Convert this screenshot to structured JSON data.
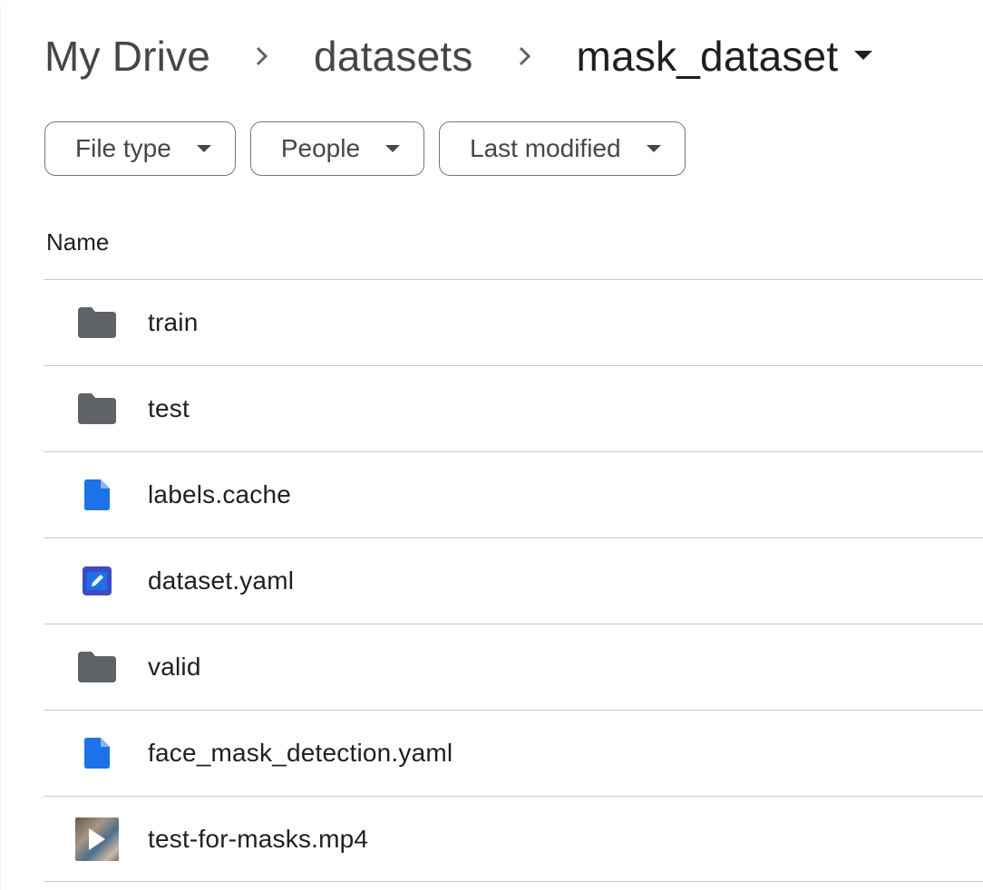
{
  "breadcrumb": {
    "items": [
      "My Drive",
      "datasets"
    ],
    "current": "mask_dataset"
  },
  "filters": [
    {
      "label": "File type"
    },
    {
      "label": "People"
    },
    {
      "label": "Last modified"
    }
  ],
  "table": {
    "header_name": "Name",
    "rows": [
      {
        "name": "train",
        "icon": "folder-icon"
      },
      {
        "name": "test",
        "icon": "folder-icon"
      },
      {
        "name": "labels.cache",
        "icon": "file-icon"
      },
      {
        "name": "dataset.yaml",
        "icon": "edit-file-icon"
      },
      {
        "name": "valid",
        "icon": "folder-icon"
      },
      {
        "name": "face_mask_detection.yaml",
        "icon": "file-icon"
      },
      {
        "name": "test-for-masks.mp4",
        "icon": "video-thumbnail-icon"
      }
    ]
  },
  "colors": {
    "folder": "#5f6368",
    "file": "#1a73e8",
    "edit_file_bg": "#3e4ac7",
    "edit_file_inner": "#1a73e8",
    "divider": "#c4c7c5"
  }
}
